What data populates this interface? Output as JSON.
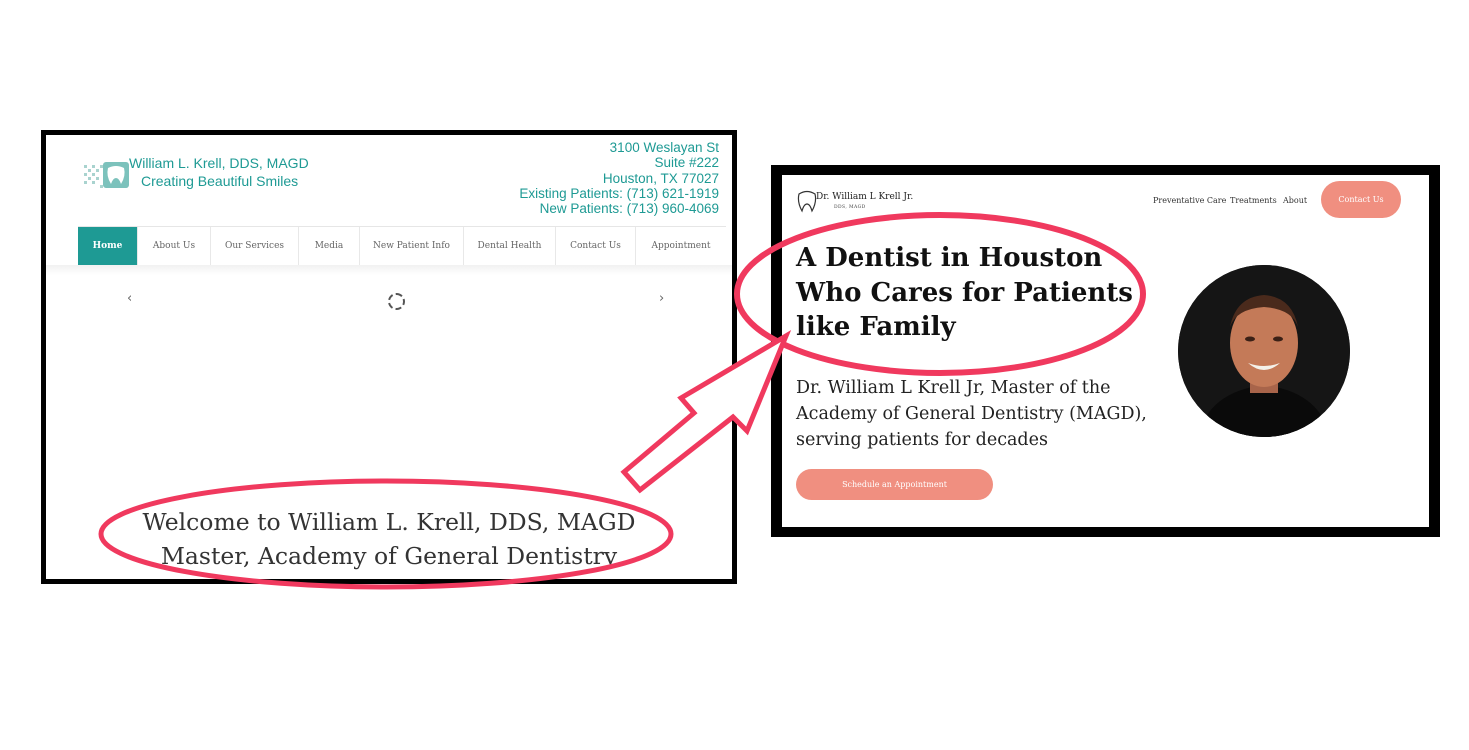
{
  "old_site": {
    "brand_name": "William L. Krell,  DDS,  MAGD",
    "tagline": "Creating Beautiful Smiles",
    "address": {
      "street": "3100 Weslayan St",
      "suite": "Suite #222",
      "city": "Houston, TX 77027",
      "existing_patients": "Existing Patients: (713) 621-1919",
      "new_patients": "New Patients: (713) 960-4069"
    },
    "nav": [
      {
        "label": "Home",
        "active": true
      },
      {
        "label": "About Us"
      },
      {
        "label": "Our Services"
      },
      {
        "label": "Media"
      },
      {
        "label": "New Patient Info"
      },
      {
        "label": "Dental Health"
      },
      {
        "label": "Contact Us"
      },
      {
        "label": "Appointment"
      }
    ],
    "slider": {
      "prev": "‹",
      "next": "›"
    },
    "welcome_line1": "Welcome to William L. Krell, DDS, MAGD",
    "welcome_line2": "Master, Academy of General Dentistry"
  },
  "new_site": {
    "logo_name": "Dr. William L Krell Jr.",
    "logo_sub": "DDS, MAGD",
    "nav": [
      "Preventative Care",
      "Treatments",
      "About"
    ],
    "contact_button": "Contact Us",
    "headline": [
      "A Dentist in Houston",
      "Who Cares for Patients",
      "like Family"
    ],
    "subheading": [
      "Dr. William L Krell Jr, Master of the",
      "Academy of General Dentistry (MAGD),",
      "serving patients for decades"
    ],
    "schedule_button": "Schedule an Appointment"
  },
  "colors": {
    "old_teal": "#1e9a94",
    "new_accent": "#f08f80",
    "annotation": "#f0395e"
  }
}
